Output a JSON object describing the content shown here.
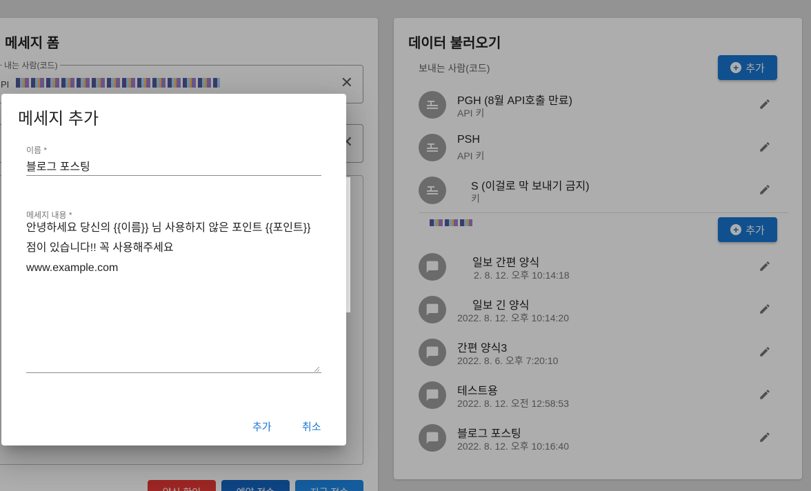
{
  "left_card": {
    "title": "메세지 폼",
    "sender_field": {
      "legend": "내는 사람(코드)",
      "prefix": "PI",
      "clear_icon": "close-icon"
    },
    "bottom_buttons": [
      {
        "label": "양식 확인",
        "color": "#e53935"
      },
      {
        "label": "예약 전송",
        "color": "#1565c0"
      },
      {
        "label": "지금 전송",
        "color": "#1e88e5"
      }
    ]
  },
  "right_card": {
    "title": "데이터 불러오기",
    "sender_section_label": "보내는 사람(코드)",
    "add_label": "추가",
    "senders": [
      {
        "name": "PGH (8월 API호출 만료)",
        "sub": "API 키",
        "icon": "key-icon"
      },
      {
        "name": "PSH",
        "sub": "API 키",
        "icon": "key-icon"
      },
      {
        "name": "S (이걸로 막 보내기 금지)",
        "sub": "키",
        "icon": "key-icon"
      }
    ],
    "templates": [
      {
        "name": "일보 간편 양식",
        "sub": "2. 8. 12. 오후 10:14:18",
        "icon": "chat-icon"
      },
      {
        "name": "일보 긴 양식",
        "sub": "2022. 8. 12. 오후 10:14:20",
        "icon": "chat-icon"
      },
      {
        "name": "간편 양식3",
        "sub": "2022. 8. 6. 오후 7:20:10",
        "icon": "chat-icon"
      },
      {
        "name": "테스트용",
        "sub": "2022. 8. 12. 오전 12:58:53",
        "icon": "chat-icon"
      },
      {
        "name": "블로그 포스팅",
        "sub": "2022. 8. 12. 오후 10:16:40",
        "icon": "chat-icon"
      }
    ]
  },
  "dialog": {
    "title": "메세지 추가",
    "name_label": "이름 *",
    "name_value": "블로그 포스팅",
    "content_label": "메세지 내용 *",
    "content_value": "안녕하세요 당신의 {{이름}} 님 사용하지 않은 포인트 {{포인트}} 점이 있습니다!! 꼭 사용해주세요\nwww.example.com",
    "add_button": "추가",
    "cancel_button": "취소"
  },
  "colors": {
    "primary": "#1976d2",
    "overlay": "rgba(0,0,0,0.32)",
    "avatar": "#9e9e9e"
  }
}
